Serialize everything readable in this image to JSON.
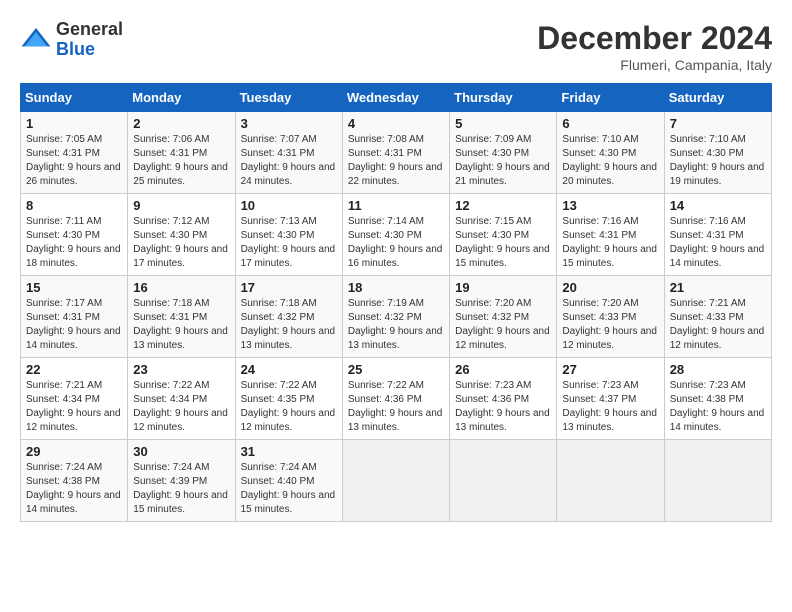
{
  "header": {
    "logo_line1": "General",
    "logo_line2": "Blue",
    "month": "December 2024",
    "location": "Flumeri, Campania, Italy"
  },
  "days_of_week": [
    "Sunday",
    "Monday",
    "Tuesday",
    "Wednesday",
    "Thursday",
    "Friday",
    "Saturday"
  ],
  "weeks": [
    [
      {
        "day": "1",
        "sunrise": "Sunrise: 7:05 AM",
        "sunset": "Sunset: 4:31 PM",
        "daylight": "Daylight: 9 hours and 26 minutes."
      },
      {
        "day": "2",
        "sunrise": "Sunrise: 7:06 AM",
        "sunset": "Sunset: 4:31 PM",
        "daylight": "Daylight: 9 hours and 25 minutes."
      },
      {
        "day": "3",
        "sunrise": "Sunrise: 7:07 AM",
        "sunset": "Sunset: 4:31 PM",
        "daylight": "Daylight: 9 hours and 24 minutes."
      },
      {
        "day": "4",
        "sunrise": "Sunrise: 7:08 AM",
        "sunset": "Sunset: 4:31 PM",
        "daylight": "Daylight: 9 hours and 22 minutes."
      },
      {
        "day": "5",
        "sunrise": "Sunrise: 7:09 AM",
        "sunset": "Sunset: 4:30 PM",
        "daylight": "Daylight: 9 hours and 21 minutes."
      },
      {
        "day": "6",
        "sunrise": "Sunrise: 7:10 AM",
        "sunset": "Sunset: 4:30 PM",
        "daylight": "Daylight: 9 hours and 20 minutes."
      },
      {
        "day": "7",
        "sunrise": "Sunrise: 7:10 AM",
        "sunset": "Sunset: 4:30 PM",
        "daylight": "Daylight: 9 hours and 19 minutes."
      }
    ],
    [
      {
        "day": "8",
        "sunrise": "Sunrise: 7:11 AM",
        "sunset": "Sunset: 4:30 PM",
        "daylight": "Daylight: 9 hours and 18 minutes."
      },
      {
        "day": "9",
        "sunrise": "Sunrise: 7:12 AM",
        "sunset": "Sunset: 4:30 PM",
        "daylight": "Daylight: 9 hours and 17 minutes."
      },
      {
        "day": "10",
        "sunrise": "Sunrise: 7:13 AM",
        "sunset": "Sunset: 4:30 PM",
        "daylight": "Daylight: 9 hours and 17 minutes."
      },
      {
        "day": "11",
        "sunrise": "Sunrise: 7:14 AM",
        "sunset": "Sunset: 4:30 PM",
        "daylight": "Daylight: 9 hours and 16 minutes."
      },
      {
        "day": "12",
        "sunrise": "Sunrise: 7:15 AM",
        "sunset": "Sunset: 4:30 PM",
        "daylight": "Daylight: 9 hours and 15 minutes."
      },
      {
        "day": "13",
        "sunrise": "Sunrise: 7:16 AM",
        "sunset": "Sunset: 4:31 PM",
        "daylight": "Daylight: 9 hours and 15 minutes."
      },
      {
        "day": "14",
        "sunrise": "Sunrise: 7:16 AM",
        "sunset": "Sunset: 4:31 PM",
        "daylight": "Daylight: 9 hours and 14 minutes."
      }
    ],
    [
      {
        "day": "15",
        "sunrise": "Sunrise: 7:17 AM",
        "sunset": "Sunset: 4:31 PM",
        "daylight": "Daylight: 9 hours and 14 minutes."
      },
      {
        "day": "16",
        "sunrise": "Sunrise: 7:18 AM",
        "sunset": "Sunset: 4:31 PM",
        "daylight": "Daylight: 9 hours and 13 minutes."
      },
      {
        "day": "17",
        "sunrise": "Sunrise: 7:18 AM",
        "sunset": "Sunset: 4:32 PM",
        "daylight": "Daylight: 9 hours and 13 minutes."
      },
      {
        "day": "18",
        "sunrise": "Sunrise: 7:19 AM",
        "sunset": "Sunset: 4:32 PM",
        "daylight": "Daylight: 9 hours and 13 minutes."
      },
      {
        "day": "19",
        "sunrise": "Sunrise: 7:20 AM",
        "sunset": "Sunset: 4:32 PM",
        "daylight": "Daylight: 9 hours and 12 minutes."
      },
      {
        "day": "20",
        "sunrise": "Sunrise: 7:20 AM",
        "sunset": "Sunset: 4:33 PM",
        "daylight": "Daylight: 9 hours and 12 minutes."
      },
      {
        "day": "21",
        "sunrise": "Sunrise: 7:21 AM",
        "sunset": "Sunset: 4:33 PM",
        "daylight": "Daylight: 9 hours and 12 minutes."
      }
    ],
    [
      {
        "day": "22",
        "sunrise": "Sunrise: 7:21 AM",
        "sunset": "Sunset: 4:34 PM",
        "daylight": "Daylight: 9 hours and 12 minutes."
      },
      {
        "day": "23",
        "sunrise": "Sunrise: 7:22 AM",
        "sunset": "Sunset: 4:34 PM",
        "daylight": "Daylight: 9 hours and 12 minutes."
      },
      {
        "day": "24",
        "sunrise": "Sunrise: 7:22 AM",
        "sunset": "Sunset: 4:35 PM",
        "daylight": "Daylight: 9 hours and 12 minutes."
      },
      {
        "day": "25",
        "sunrise": "Sunrise: 7:22 AM",
        "sunset": "Sunset: 4:36 PM",
        "daylight": "Daylight: 9 hours and 13 minutes."
      },
      {
        "day": "26",
        "sunrise": "Sunrise: 7:23 AM",
        "sunset": "Sunset: 4:36 PM",
        "daylight": "Daylight: 9 hours and 13 minutes."
      },
      {
        "day": "27",
        "sunrise": "Sunrise: 7:23 AM",
        "sunset": "Sunset: 4:37 PM",
        "daylight": "Daylight: 9 hours and 13 minutes."
      },
      {
        "day": "28",
        "sunrise": "Sunrise: 7:23 AM",
        "sunset": "Sunset: 4:38 PM",
        "daylight": "Daylight: 9 hours and 14 minutes."
      }
    ],
    [
      {
        "day": "29",
        "sunrise": "Sunrise: 7:24 AM",
        "sunset": "Sunset: 4:38 PM",
        "daylight": "Daylight: 9 hours and 14 minutes."
      },
      {
        "day": "30",
        "sunrise": "Sunrise: 7:24 AM",
        "sunset": "Sunset: 4:39 PM",
        "daylight": "Daylight: 9 hours and 15 minutes."
      },
      {
        "day": "31",
        "sunrise": "Sunrise: 7:24 AM",
        "sunset": "Sunset: 4:40 PM",
        "daylight": "Daylight: 9 hours and 15 minutes."
      },
      null,
      null,
      null,
      null
    ]
  ]
}
